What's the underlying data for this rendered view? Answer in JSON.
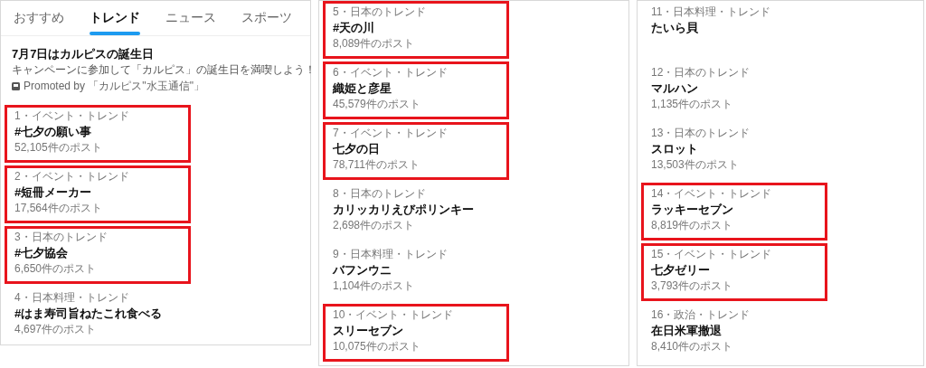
{
  "panels": [
    {
      "tabs": [
        {
          "label": "おすすめ",
          "selected": false
        },
        {
          "label": "トレンド",
          "selected": true
        },
        {
          "label": "ニュース",
          "selected": false
        },
        {
          "label": "スポーツ",
          "selected": false
        }
      ],
      "promo": {
        "title": "7月7日はカルピスの誕生日",
        "text": "キャンペーンに参加して「カルピス」の誕生日を満喫しよう！",
        "promoted_by": "Promoted by 「カルピス\"水玉通信\"」"
      },
      "trends": [
        {
          "meta": "1・イベント・トレンド",
          "title": "#七夕の願い事",
          "count": "52,105件のポスト",
          "highlighted": true
        },
        {
          "meta": "2・イベント・トレンド",
          "title": "#短冊メーカー",
          "count": "17,564件のポスト",
          "highlighted": true
        },
        {
          "meta": "3・日本のトレンド",
          "title": "#七夕協会",
          "count": "6,650件のポスト",
          "highlighted": true
        },
        {
          "meta": "4・日本料理・トレンド",
          "title": "#はま寿司旨ねたこれ食べる",
          "count": "4,697件のポスト",
          "highlighted": false
        }
      ]
    },
    {
      "trends": [
        {
          "meta": "5・日本のトレンド",
          "title": "#天の川",
          "count": "8,089件のポスト",
          "highlighted": true
        },
        {
          "meta": "6・イベント・トレンド",
          "title": "織姫と彦星",
          "count": "45,579件のポスト",
          "highlighted": true
        },
        {
          "meta": "7・イベント・トレンド",
          "title": "七夕の日",
          "count": "78,711件のポスト",
          "highlighted": true
        },
        {
          "meta": "8・日本のトレンド",
          "title": "カリッカリえびポリンキー",
          "count": "2,698件のポスト",
          "highlighted": false
        },
        {
          "meta": "9・日本料理・トレンド",
          "title": "バフンウニ",
          "count": "1,104件のポスト",
          "highlighted": false
        },
        {
          "meta": "10・イベント・トレンド",
          "title": "スリーセブン",
          "count": "10,075件のポスト",
          "highlighted": true
        }
      ]
    },
    {
      "trends": [
        {
          "meta": "11・日本料理・トレンド",
          "title": "たいら貝",
          "highlighted": false
        },
        {
          "meta": "12・日本のトレンド",
          "title": "マルハン",
          "count": "1,135件のポスト",
          "highlighted": false
        },
        {
          "meta": "13・日本のトレンド",
          "title": "スロット",
          "count": "13,503件のポスト",
          "highlighted": false
        },
        {
          "meta": "14・イベント・トレンド",
          "title": "ラッキーセブン",
          "count": "8,819件のポスト",
          "highlighted": true
        },
        {
          "meta": "15・イベント・トレンド",
          "title": "七夕ゼリー",
          "count": "3,793件のポスト",
          "highlighted": true
        },
        {
          "meta": "16・政治・トレンド",
          "title": "在日米軍撤退",
          "count": "8,410件のポスト",
          "highlighted": false
        }
      ]
    }
  ]
}
